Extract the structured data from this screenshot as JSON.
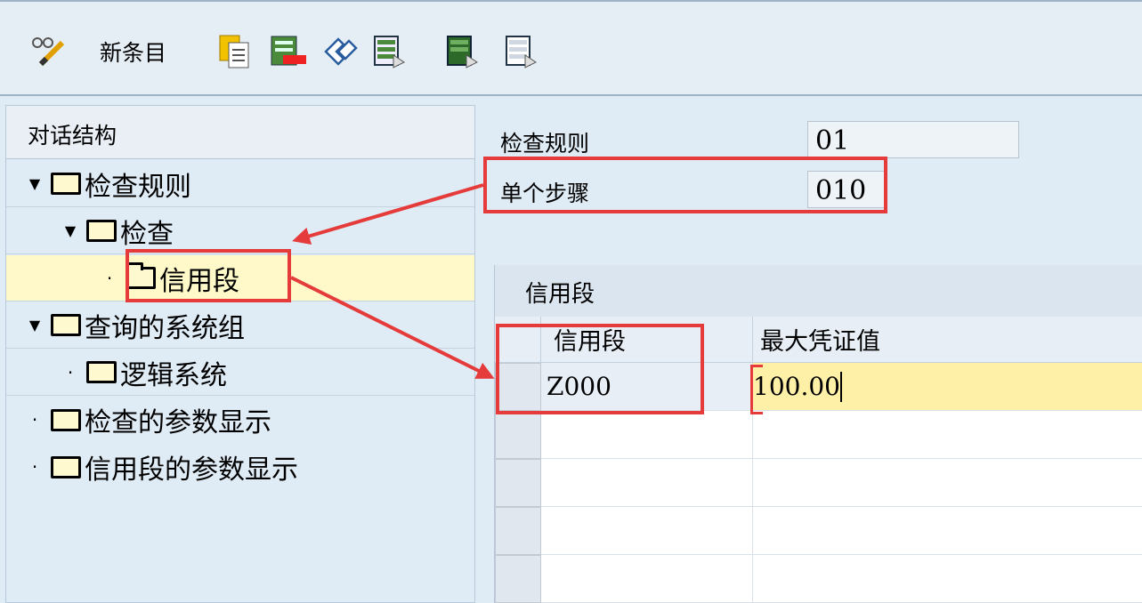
{
  "toolbar": {
    "new_entry_label": "新条目",
    "icons": [
      "edit-glasses-icon",
      "copy-icon",
      "delete-icon",
      "undo-icon",
      "select-icon",
      "select-block-icon",
      "deselect-icon"
    ]
  },
  "nav": {
    "header": "对话结构",
    "items": [
      {
        "label": "检查规则"
      },
      {
        "label": "检查"
      },
      {
        "label": "信用段"
      },
      {
        "label": "查询的系统组"
      },
      {
        "label": "逻辑系统"
      },
      {
        "label": "检查的参数显示"
      },
      {
        "label": "信用段的参数显示"
      }
    ]
  },
  "fields": {
    "check_rule_label": "检查规则",
    "check_rule_value": "01",
    "step_label": "单个步骤",
    "step_value": "010"
  },
  "table": {
    "title": "信用段",
    "columns": [
      "信用段",
      "最大凭证值"
    ],
    "rows": [
      {
        "segment": "Z000",
        "max_value": "100.00"
      }
    ]
  },
  "colors": {
    "highlight_red": "#e53b3b",
    "selected_row": "#fff8c8",
    "edit_cell": "#fff0a8"
  }
}
